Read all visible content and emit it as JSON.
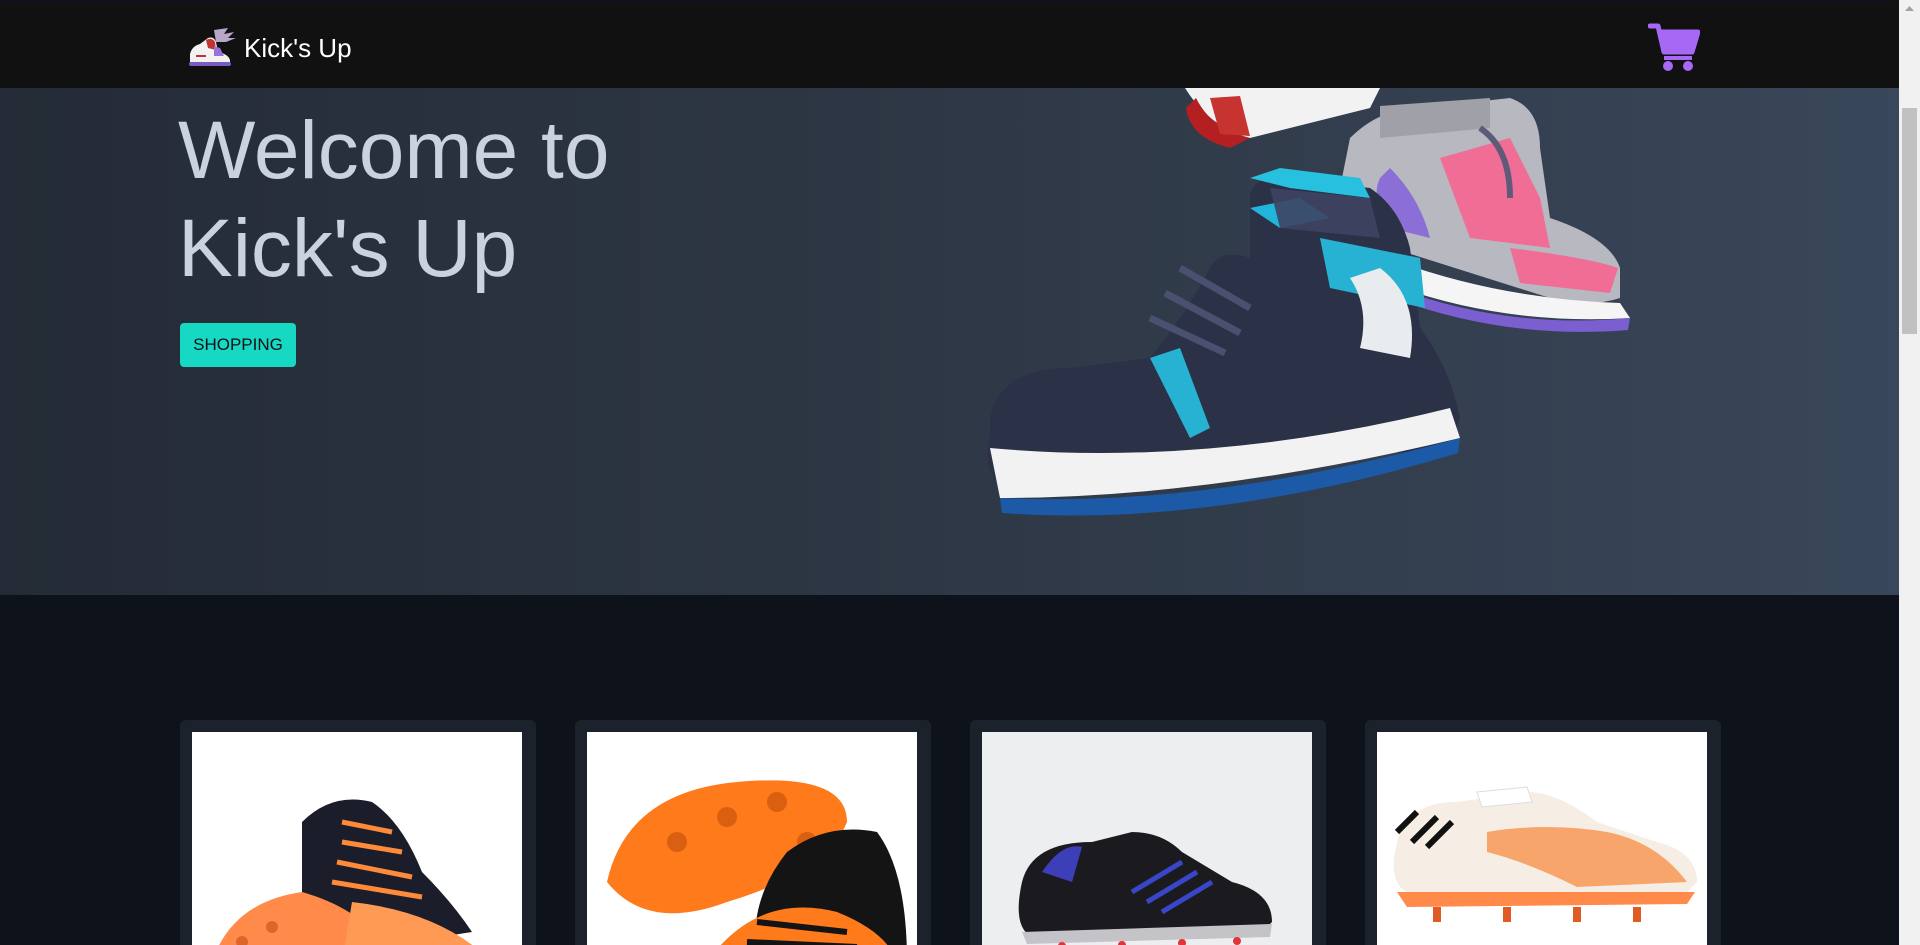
{
  "navbar": {
    "brand_name": "Kick's Up",
    "logo_icon": "winged-sneaker-logo",
    "cart_icon": "shopping-cart-icon",
    "cart_color": "#a768f6"
  },
  "hero": {
    "title_line1": "Welcome to",
    "title_line2": "Kick's Up",
    "button_label": "SHOPPING",
    "button_color": "#17d8c3",
    "image_subject": "high-top-sneakers"
  },
  "products": [
    {
      "image_subject": "black-orange-football-boots"
    },
    {
      "image_subject": "orange-black-football-boots-studs"
    },
    {
      "image_subject": "black-blue-football-boot"
    },
    {
      "image_subject": "white-orange-football-boot"
    }
  ]
}
